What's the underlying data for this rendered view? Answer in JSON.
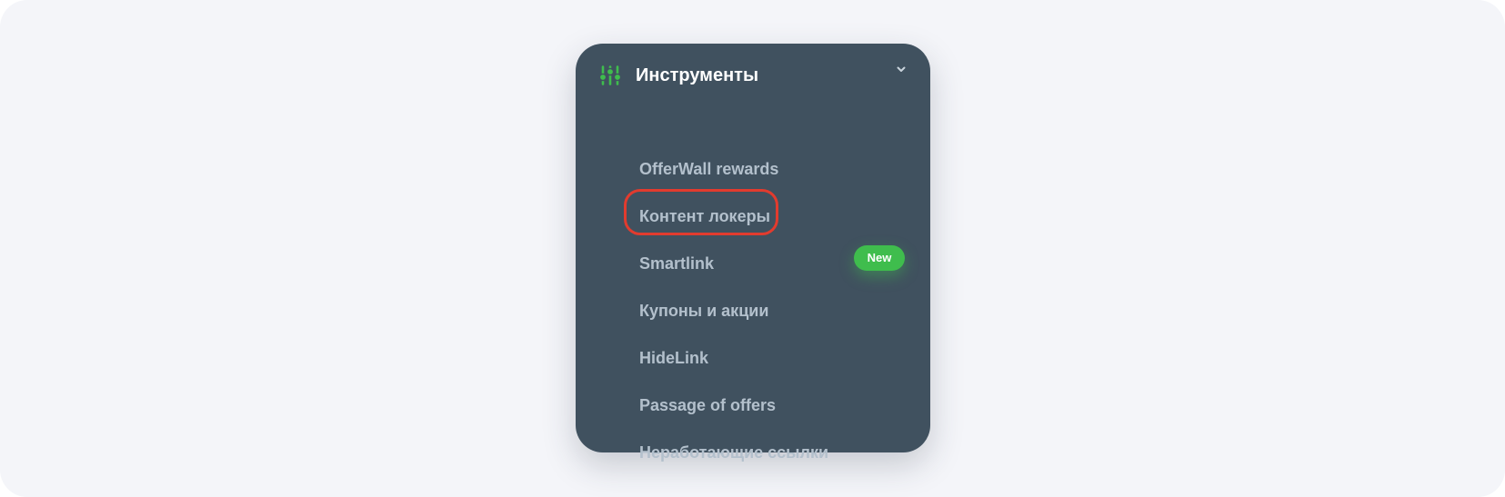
{
  "menu": {
    "title": "Инструменты",
    "header_icon": "sliders-icon",
    "expand_icon": "chevron-down-icon",
    "items": [
      {
        "label": "OfferWall rewards"
      },
      {
        "label": "Контент локеры",
        "highlighted": true
      },
      {
        "label": "Smartlink",
        "badge": "New"
      },
      {
        "label": "Купоны и акции"
      },
      {
        "label": "HideLink"
      },
      {
        "label": "Passage of offers"
      },
      {
        "label": "Неработающие ссылки"
      }
    ]
  },
  "colors": {
    "page_background": "#f4f5f9",
    "panel_background": "#40515f",
    "title_text": "#ffffff",
    "item_text": "#b3c0cc",
    "icon_accent": "#3fbd4d",
    "badge_background": "#3fbd4d",
    "highlight_ring": "#e23b2e"
  }
}
